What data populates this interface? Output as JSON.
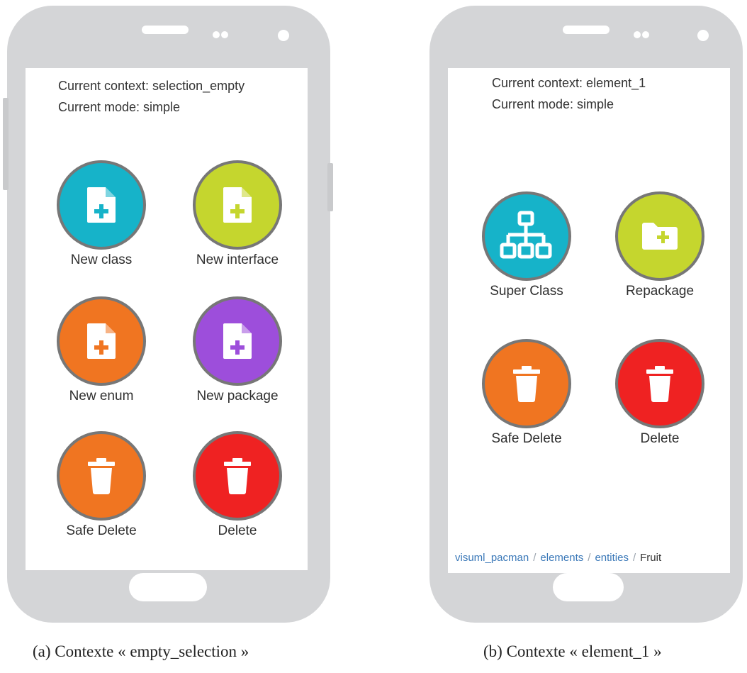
{
  "panel_a": {
    "context_text": "Current context: selection_empty",
    "mode_text": "Current mode: simple",
    "actions": [
      {
        "label": "New class",
        "color": "#16b3c9",
        "icon": "file-plus-icon"
      },
      {
        "label": "New interface",
        "color": "#c5d62e",
        "icon": "file-plus-icon"
      },
      {
        "label": "New enum",
        "color": "#f07521",
        "icon": "file-plus-icon"
      },
      {
        "label": "New package",
        "color": "#9d4edb",
        "icon": "file-plus-icon"
      },
      {
        "label": "Safe Delete",
        "color": "#f07521",
        "icon": "trash-icon"
      },
      {
        "label": "Delete",
        "color": "#ef2222",
        "icon": "trash-icon"
      }
    ],
    "caption": "(a) Contexte « empty_selection »"
  },
  "panel_b": {
    "context_text": "Current context: element_1",
    "mode_text": "Current mode: simple",
    "actions": [
      {
        "label": "Super Class",
        "color": "#16b3c9",
        "icon": "hierarchy-icon"
      },
      {
        "label": "Repackage",
        "color": "#c5d62e",
        "icon": "folder-plus-icon"
      },
      {
        "label": "Safe Delete",
        "color": "#f07521",
        "icon": "trash-icon"
      },
      {
        "label": "Delete",
        "color": "#ef2222",
        "icon": "trash-icon"
      }
    ],
    "breadcrumb": [
      "visuml_pacman",
      "elements",
      "entities",
      "Fruit"
    ],
    "caption": "(b) Contexte « element_1 »"
  }
}
